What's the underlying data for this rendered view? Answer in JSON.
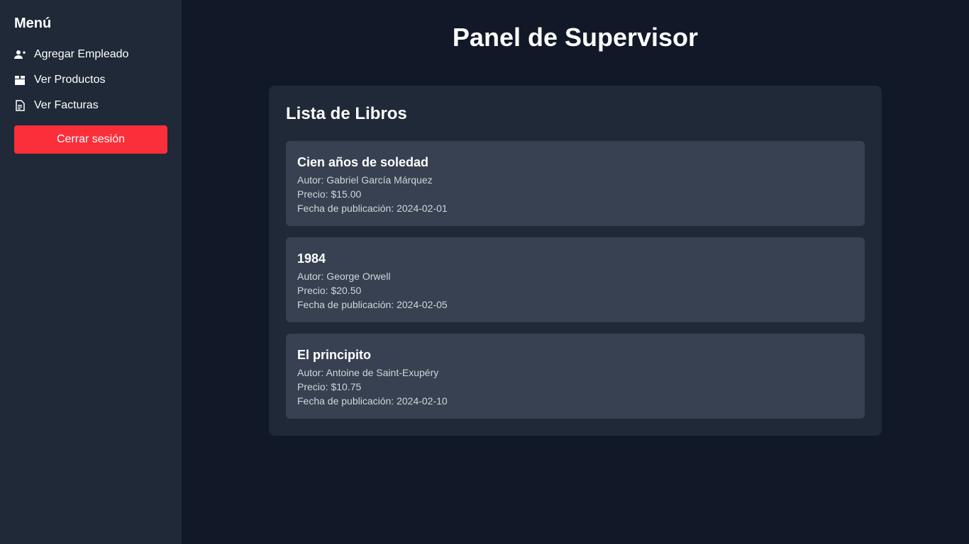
{
  "sidebar": {
    "title": "Menú",
    "items": [
      {
        "label": "Agregar Empleado",
        "icon": "user-plus-icon"
      },
      {
        "label": "Ver Productos",
        "icon": "box-icon"
      },
      {
        "label": "Ver Facturas",
        "icon": "file-invoice-icon"
      }
    ],
    "logout_label": "Cerrar sesión"
  },
  "header": {
    "title": "Panel de Supervisor"
  },
  "panel": {
    "title": "Lista de Libros",
    "books": [
      {
        "title": "Cien años de soledad",
        "author": "Autor: Gabriel García Márquez",
        "price": "Precio: $15.00",
        "date": "Fecha de publicación: 2024-02-01"
      },
      {
        "title": "1984",
        "author": "Autor: George Orwell",
        "price": "Precio: $20.50",
        "date": "Fecha de publicación: 2024-02-05"
      },
      {
        "title": "El principito",
        "author": "Autor: Antoine de Saint-Exupéry",
        "price": "Precio: $10.75",
        "date": "Fecha de publicación: 2024-02-10"
      }
    ]
  },
  "colors": {
    "background": "#111827",
    "sidebar": "#1f2937",
    "card": "#374151",
    "logout": "#fa2f3a"
  }
}
